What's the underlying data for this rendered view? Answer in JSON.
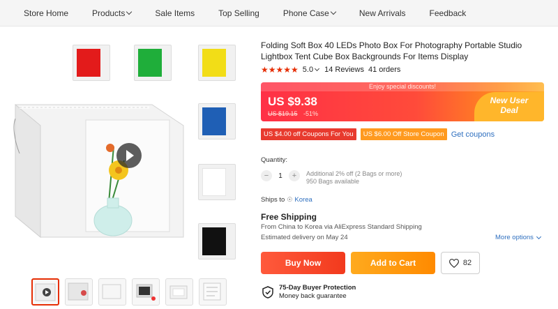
{
  "nav": {
    "items": [
      {
        "label": "Store Home",
        "dropdown": false
      },
      {
        "label": "Products",
        "dropdown": true
      },
      {
        "label": "Sale Items",
        "dropdown": false
      },
      {
        "label": "Top Selling",
        "dropdown": false
      },
      {
        "label": "Phone Case",
        "dropdown": true
      },
      {
        "label": "New Arrivals",
        "dropdown": false
      },
      {
        "label": "Feedback",
        "dropdown": false
      }
    ]
  },
  "gallery": {
    "color_variants": [
      "#e31b1b",
      "#1fae3a",
      "#f2dd17",
      "#1f5fb5",
      "#ffffff",
      "#111111"
    ],
    "thumbnail_count": 6
  },
  "product": {
    "title": "Folding Soft Box 40 LEDs Photo Box For Photography Portable Studio Lightbox Tent Cube Box Backgrounds For Items Display",
    "stars": "★★★★★",
    "rating": "5.0",
    "reviews": "14 Reviews",
    "orders": "41 orders"
  },
  "price": {
    "banner_text": "Enjoy special discounts!",
    "current": "US $9.38",
    "original": "US $19.15",
    "discount": "-51%",
    "new_user_line1": "New User",
    "new_user_line2": "Deal"
  },
  "coupons": {
    "coupon1": "US $4.00 off Coupons For You",
    "coupon2": "US $6.00 Off Store Coupon",
    "get_coupons": "Get coupons"
  },
  "quantity": {
    "label": "Quantity:",
    "minus": "−",
    "value": "1",
    "plus": "+",
    "note1": "Additional 2% off (2 Bags or more)",
    "note2": "950 Bags available"
  },
  "shipping": {
    "ships_to": "Ships to",
    "destination": "Korea",
    "free_shipping": "Free Shipping",
    "from_line": "From China to Korea via AliExpress Standard Shipping",
    "delivery": "Estimated delivery on May 24",
    "more_options": "More options"
  },
  "actions": {
    "buy_now": "Buy Now",
    "add_to_cart": "Add to Cart",
    "wishlist_count": "82"
  },
  "protection": {
    "title": "75-Day Buyer Protection",
    "subtitle": "Money back guarantee"
  },
  "colors": {
    "accent": "#e62e04",
    "link": "#2e6fbf",
    "buy_now": "#f23a1d",
    "add_to_cart": "#ff8a00"
  }
}
